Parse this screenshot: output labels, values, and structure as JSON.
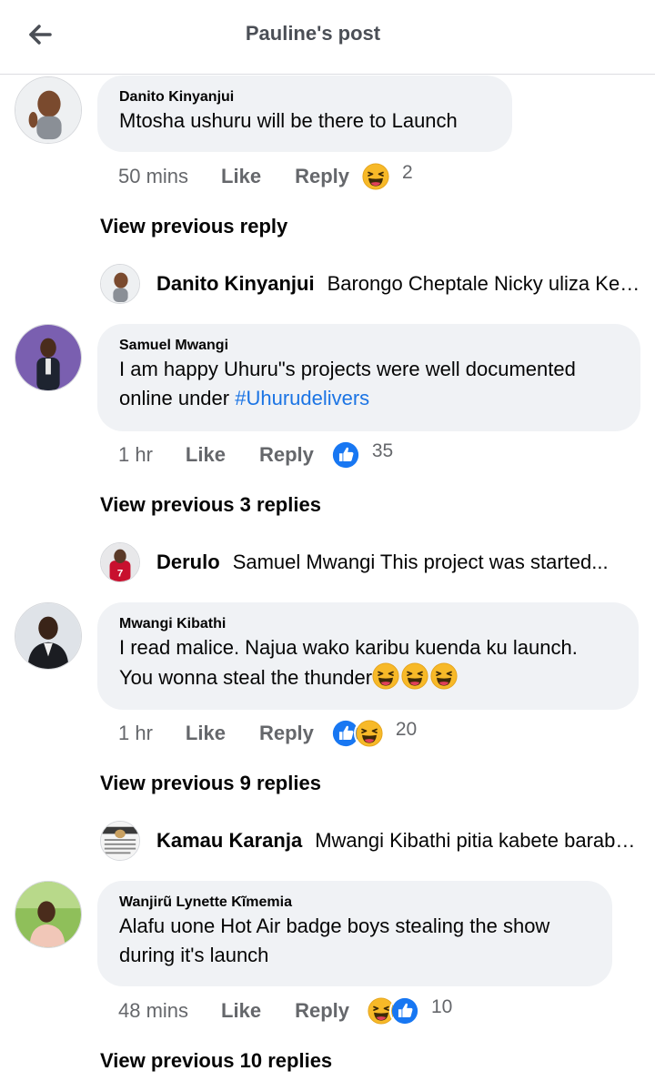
{
  "header": {
    "title": "Pauline's post",
    "back_icon": "arrow-left-icon"
  },
  "comments": [
    {
      "author": "Danito Kinyanjui",
      "text": "Mtosha ushuru will be there to Launch",
      "time": "50 mins",
      "like_label": "Like",
      "reply_label": "Reply",
      "reactions": [
        "haha"
      ],
      "reaction_count": "2",
      "view_previous": "View previous reply",
      "latest_reply": {
        "author": "Danito Kinyanjui",
        "snippet": "Barongo Cheptale Nicky uliza Kenya..."
      }
    },
    {
      "author": "Samuel Mwangi",
      "text_line1": "I am happy Uhuru\"s projects were well documented",
      "text_line2": "online under ",
      "hashtag": "#Uhurudelivers",
      "time": "1 hr",
      "like_label": "Like",
      "reply_label": "Reply",
      "reactions": [
        "like"
      ],
      "reaction_count": "35",
      "view_previous": "View previous 3 replies",
      "latest_reply": {
        "author": "Derulo",
        "snippet": "Samuel Mwangi This project was started..."
      }
    },
    {
      "author": "Mwangi Kibathi",
      "text_line1": "I read malice. Najua wako karibu kuenda ku launch.",
      "text_line2": "You wonna steal the thunder",
      "inline_emoji": [
        "haha",
        "haha",
        "haha"
      ],
      "time": "1 hr",
      "like_label": "Like",
      "reply_label": "Reply",
      "reactions": [
        "like",
        "haha"
      ],
      "reaction_count": "20",
      "view_previous": "View previous 9 replies",
      "latest_reply": {
        "author": "Kamau Karanja",
        "snippet": "Mwangi Kibathi pitia kabete barabara..."
      }
    },
    {
      "author": "Wanjirũ Lynette Kĩmemia",
      "text_line1": "Alafu uone Hot Air badge boys stealing the show",
      "text_line2": "during it's launch",
      "time": "48 mins",
      "like_label": "Like",
      "reply_label": "Reply",
      "reactions": [
        "haha",
        "like"
      ],
      "reaction_count": "10",
      "view_previous": "View previous 10 replies"
    }
  ],
  "colors": {
    "bubble": "#f0f2f5",
    "link_blue": "#1b74e4",
    "like_blue": "#1877f2",
    "haha_yellow": "#f7b928",
    "muted": "#65676b"
  }
}
